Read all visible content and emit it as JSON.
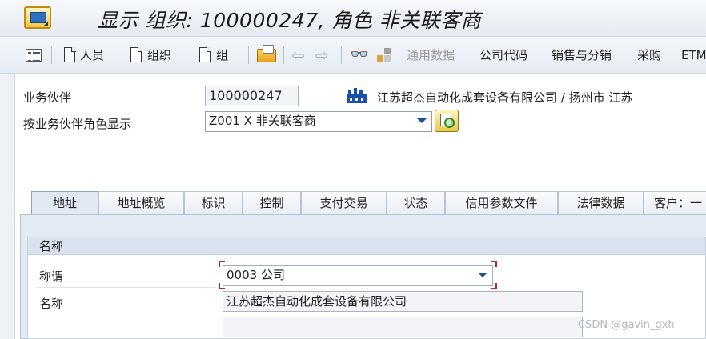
{
  "title": "显示 组织: 100000247, 角色 非关联客商",
  "toolbar": {
    "person": "人员",
    "organization": "组织",
    "group": "组",
    "general_data": "通用数据",
    "company_code": "公司代码",
    "sales_distribution": "销售与分销",
    "purchasing": "采购",
    "etm": "ETM"
  },
  "header": {
    "bp_label": "业务伙伴",
    "bp_value": "100000247",
    "bp_description": "江苏超杰自动化成套设备有限公司 / 扬州市 江苏",
    "role_label": "按业务伙伴角色显示",
    "role_value": "Z001  X 非关联客商"
  },
  "tabs": [
    {
      "label": "地址",
      "active": true
    },
    {
      "label": "地址概览"
    },
    {
      "label": "标识"
    },
    {
      "label": "控制"
    },
    {
      "label": "支付交易"
    },
    {
      "label": "状态"
    },
    {
      "label": "信用参数文件"
    },
    {
      "label": "法律数据"
    },
    {
      "label": "客户：一"
    }
  ],
  "name_group": {
    "title": "名称",
    "salutation_label": "称谓",
    "salutation_value": "0003 公司",
    "name_label": "名称",
    "name_value": "江苏超杰自动化成套设备有限公司",
    "name2_value": ""
  },
  "watermark": "CSDN @gavin_gxh",
  "colors": {
    "accent": "#1d4f91",
    "focus": "#c0242b"
  }
}
